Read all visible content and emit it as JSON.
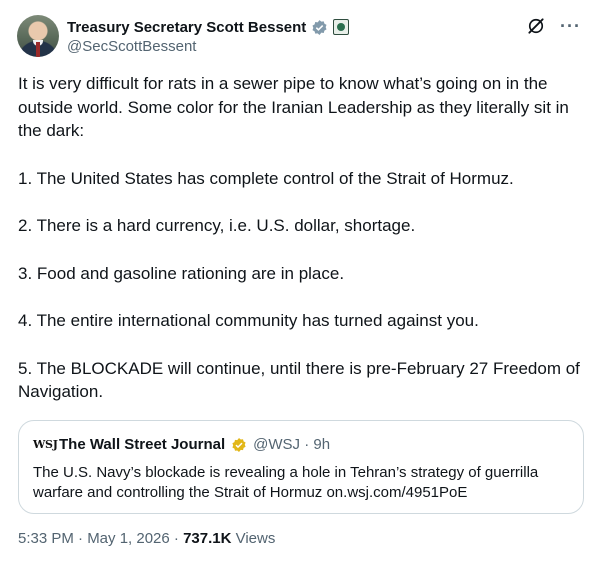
{
  "author": {
    "display_name": "Treasury Secretary Scott Bessent",
    "handle": "@SecScottBessent"
  },
  "post": {
    "paragraphs": [
      "It is very difficult for rats in a sewer pipe to know what’s going on in the outside world. Some color for the Iranian Leadership as they literally sit in the dark:",
      "1. The United States has complete control of the Strait of Hormuz.",
      "2. There is a hard currency, i.e. U.S. dollar, shortage.",
      "3. Food and gasoline rationing are in place.",
      "4. The entire international community has turned against you.",
      "5. The BLOCKADE will continue, until there is pre-February 27 Freedom of Navigation."
    ]
  },
  "quote": {
    "logo_text": "WSJ",
    "name": "The Wall Street Journal",
    "meta": "@WSJ · 9h",
    "text": "The U.S. Navy’s blockade is revealing a hole in Tehran’s strategy of guerrilla warfare and controlling the Strait of Hormuz on.wsj.com/4951PoE"
  },
  "footer": {
    "time_date": "5:33 PM · May 1, 2026 · ",
    "views_count": "737.1K",
    "views_label": " Views"
  },
  "icons": {
    "verified": "verified-badge-icon",
    "government": "government-seal-icon",
    "grok": "grok-icon",
    "more": "more-options-icon",
    "gold_badge": "gold-verified-badge-icon"
  },
  "colors": {
    "text": "#0f1419",
    "secondary": "#536471",
    "border": "#cfd9de",
    "grey_badge": "#829aab",
    "gold_badge": "#e2b719"
  }
}
